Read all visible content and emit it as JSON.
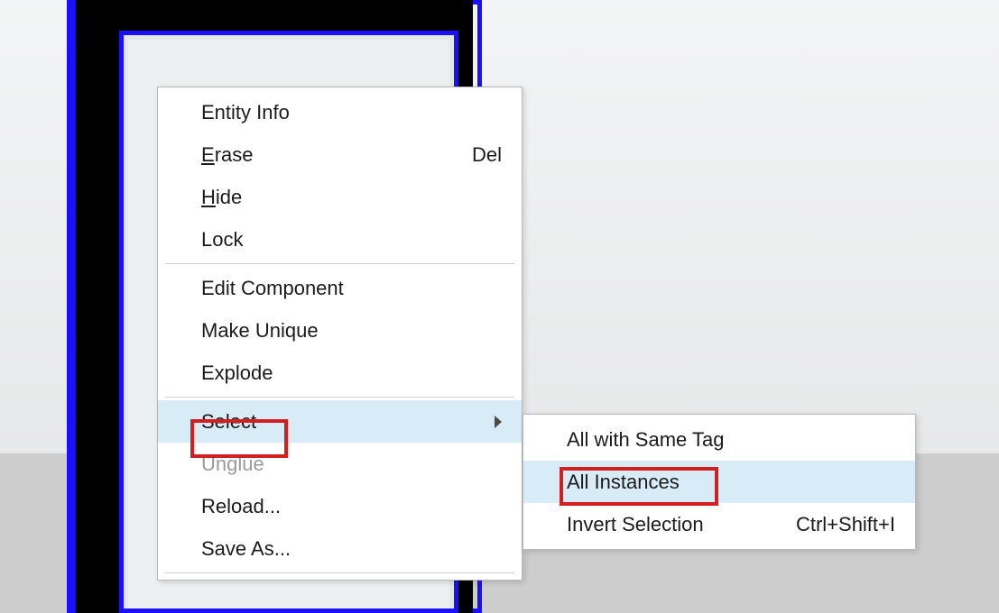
{
  "context_menu": {
    "entity_info": {
      "label": "Entity Info"
    },
    "erase": {
      "label_pre": "",
      "mnemonic": "E",
      "label_post": "rase",
      "shortcut": "Del"
    },
    "hide": {
      "label_pre": "",
      "mnemonic": "H",
      "label_post": "ide"
    },
    "lock": {
      "label": "Lock"
    },
    "edit_component": {
      "label": "Edit Component"
    },
    "make_unique": {
      "label": "Make Unique"
    },
    "explode": {
      "label": "Explode"
    },
    "select": {
      "label": "Select"
    },
    "unglue": {
      "label": "Unglue"
    },
    "reload": {
      "label": "Reload..."
    },
    "save_as": {
      "label": "Save As..."
    }
  },
  "select_submenu": {
    "all_same_tag": {
      "label": "All with Same Tag"
    },
    "all_instances": {
      "label": "All Instances"
    },
    "invert_selection": {
      "label": "Invert Selection",
      "shortcut": "Ctrl+Shift+I"
    }
  }
}
